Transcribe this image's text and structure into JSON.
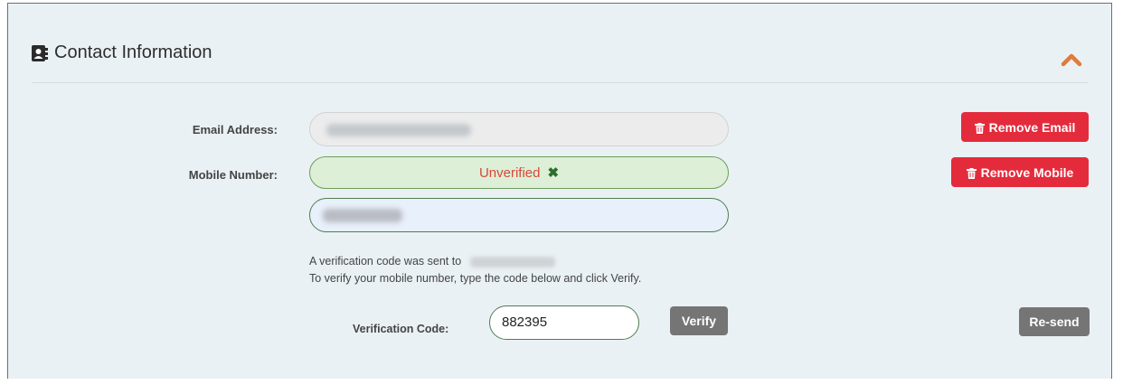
{
  "section": {
    "title": "Contact Information",
    "icon": "contact-card-icon",
    "collapse_icon": "chevron-up-icon",
    "accent_color": "#e07b39"
  },
  "email": {
    "label": "Email Address:",
    "remove_label": "Remove Email"
  },
  "mobile": {
    "label": "Mobile Number:",
    "status": "Unverified",
    "status_mark": "✖",
    "remove_label": "Remove Mobile"
  },
  "verification": {
    "notice_line1": "A verification code was sent to",
    "notice_line2": "To verify your mobile number, type the code below and click Verify.",
    "code_label": "Verification Code:",
    "code_value": "882395",
    "verify_label": "Verify",
    "resend_label": "Re-send"
  },
  "colors": {
    "danger": "#e42b3c",
    "neutral_button": "#757575",
    "panel_bg": "#eaf1f5"
  }
}
